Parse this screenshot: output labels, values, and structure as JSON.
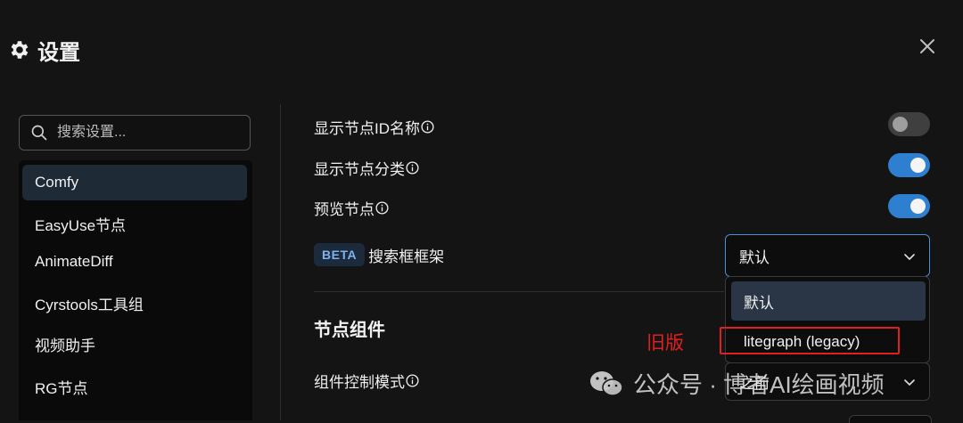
{
  "header": {
    "title": "设置",
    "icon": "gear-icon"
  },
  "search": {
    "placeholder": "搜索设置..."
  },
  "sidebar": {
    "items": [
      {
        "label": "Comfy",
        "active": true
      },
      {
        "label": "EasyUse节点"
      },
      {
        "label": "AnimateDiff"
      },
      {
        "label": "Cyrstools工具组"
      },
      {
        "label": "视频助手"
      },
      {
        "label": "RG节点"
      }
    ]
  },
  "settings": {
    "show_node_id": {
      "label": "显示节点ID名称",
      "enabled": false
    },
    "show_node_category": {
      "label": "显示节点分类",
      "enabled": true
    },
    "preview_node": {
      "label": "预览节点",
      "enabled": true
    },
    "search_box_frame": {
      "badge": "BETA",
      "label": "搜索框框架",
      "value": "默认",
      "options": [
        "默认",
        "litegraph (legacy)"
      ]
    }
  },
  "node_widgets": {
    "title": "节点组件",
    "widget_control_mode": {
      "label": "组件控制模式",
      "value": "之前"
    }
  },
  "annotation": {
    "text": "旧版",
    "color": "#e02020"
  },
  "watermark": {
    "text": "公众号 · 博者AI绘画视频"
  },
  "colors": {
    "accent": "#2f7fd0",
    "background": "#141414",
    "annotation": "#e02020"
  }
}
